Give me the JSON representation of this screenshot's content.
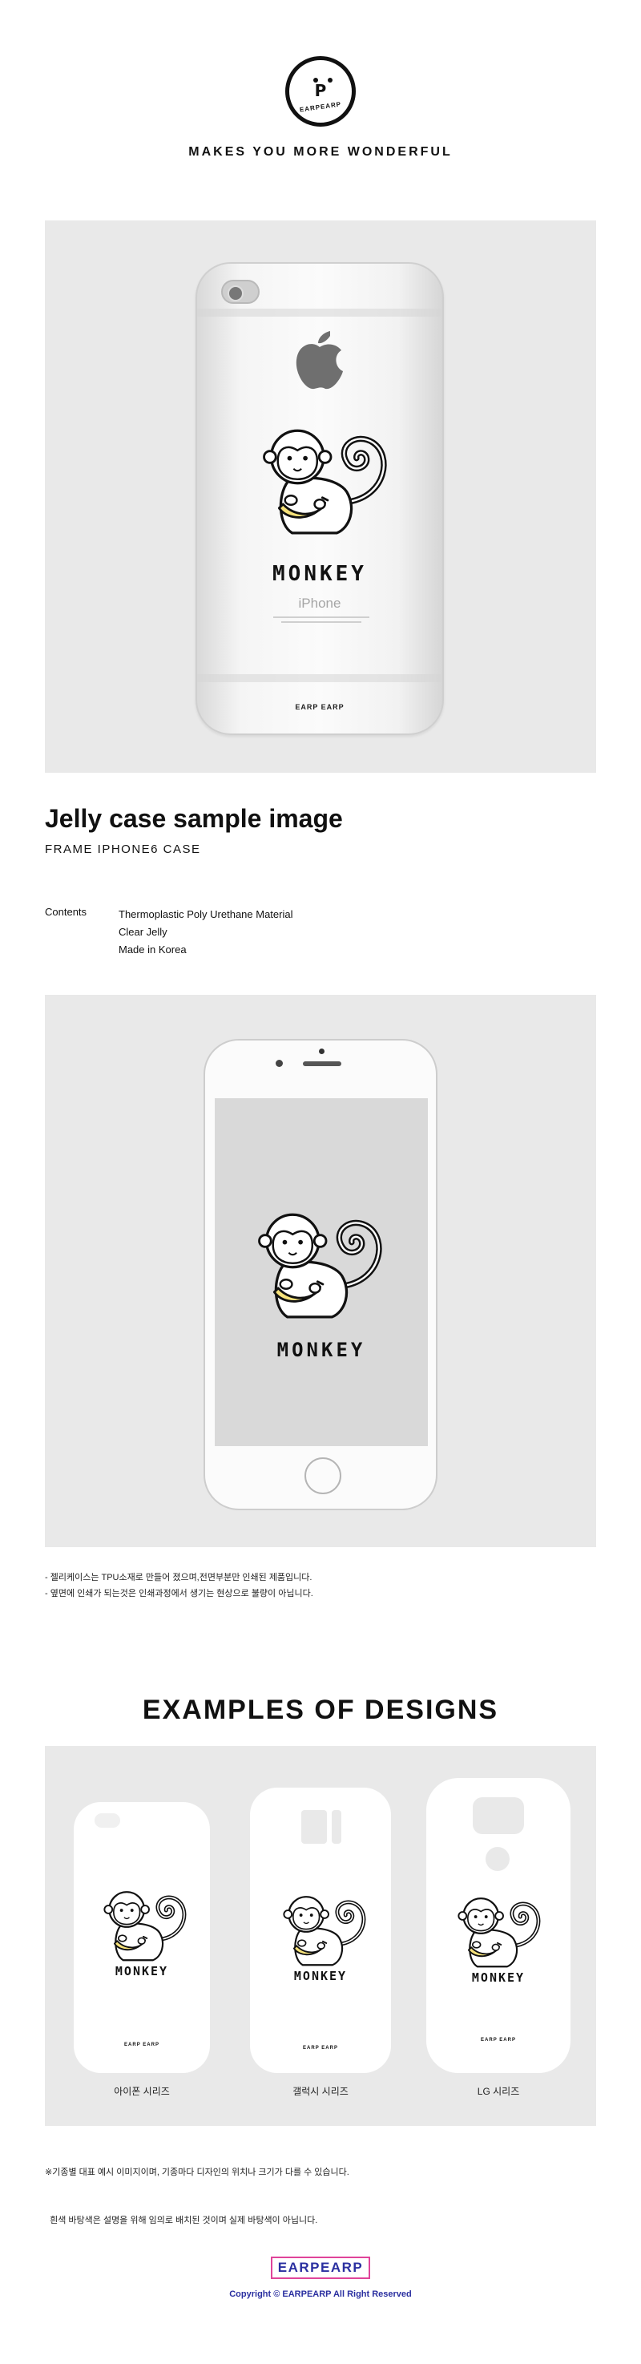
{
  "logo": {
    "letter": "P",
    "text": "EARPEARP"
  },
  "tagline": "MAKES YOU MORE WONDERFUL",
  "panel1": {
    "iphone_text": "iPhone",
    "case_brand": "EARP EARP",
    "design": "MONKEY"
  },
  "heading": {
    "title": "Jelly case sample image",
    "subtitle": "FRAME IPHONE6 CASE"
  },
  "contents": {
    "label": "Contents",
    "items": [
      "Thermoplastic Poly Urethane Material",
      "Clear Jelly",
      "Made in Korea"
    ]
  },
  "panel2": {
    "design": "MONKEY"
  },
  "notes1": [
    "- 젤리케이스는 TPU소재로 만들어 졌으며,전면부분만 인쇄된 제품입니다.",
    "- 옆면에 인쇄가 되는것은 인쇄과정에서 생기는 현상으로 불량이 아닙니다."
  ],
  "examples": {
    "title": "EXAMPLES OF DESIGNS",
    "items": [
      {
        "label": "아이폰 시리즈",
        "design": "MONKEY",
        "brand": "EARP EARP"
      },
      {
        "label": "갤럭시 시리즈",
        "design": "MONKEY",
        "brand": "EARP EARP"
      },
      {
        "label": "LG 시리즈",
        "design": "MONKEY",
        "brand": "EARP EARP"
      }
    ]
  },
  "notes2": [
    "※기종별 대표 예시 이미지이며, 기종마다 디자인의 위치나 크기가 다를 수 있습니다.",
    "  흰색 바탕색은 설명을 위해 임의로 배치된 것이며 실제 바탕색이 아닙니다."
  ],
  "footer": {
    "brand": "EARPEARP",
    "copyright": "Copyright © EARPEARP All Right Reserved"
  },
  "colors": {
    "panel_bg": "#e9e9e9",
    "banana": "#f6e27a",
    "footer_text": "#2a2fa0",
    "footer_border": "#e0449a"
  }
}
